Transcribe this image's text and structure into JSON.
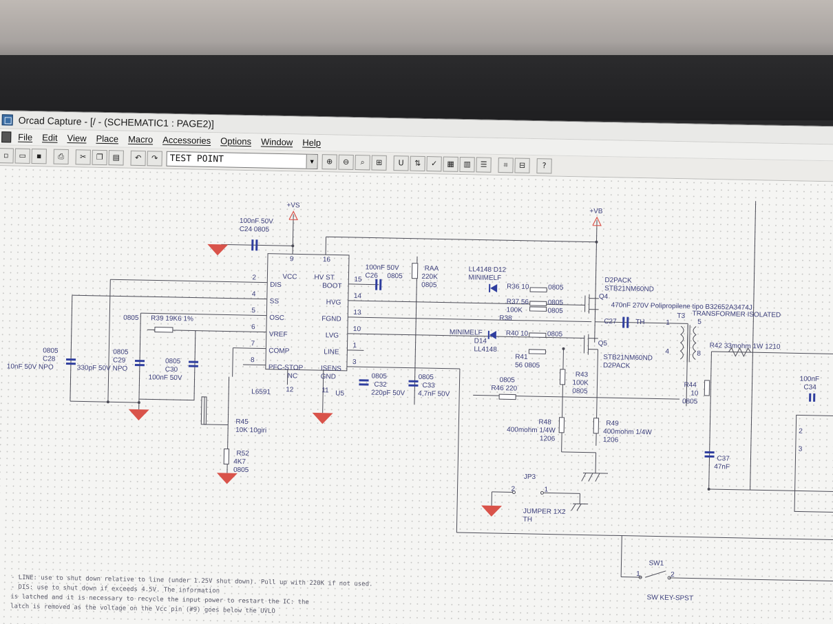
{
  "window": {
    "title": "Orcad Capture - [/ - (SCHEMATIC1 : PAGE2)]"
  },
  "menu": [
    "File",
    "Edit",
    "View",
    "Place",
    "Macro",
    "Accessories",
    "Options",
    "Window",
    "Help"
  ],
  "toolbar": {
    "part_select_value": "TEST POINT",
    "help_button": "?"
  },
  "schematic": {
    "power": {
      "vs": "+VS",
      "vb": "+VB"
    },
    "ic": {
      "name": "L6591",
      "ref": "U5",
      "pins_left": [
        "DIS",
        "SS",
        "OSC",
        "VREF",
        "COMP",
        "PFC-STOP"
      ],
      "pins_right": [
        "HV ST",
        "BOOT",
        "HVG",
        "FGND",
        "LVG",
        "LINE",
        "ISENS"
      ],
      "vcc": "VCC",
      "nc": "NC",
      "gnd": "GND",
      "pin_numbers": {
        "p9": "9",
        "p16": "16",
        "p2": "2",
        "p4": "4",
        "p5": "5",
        "p6": "6",
        "p7": "7",
        "p8": "8",
        "p15": "15",
        "p14": "14",
        "p13": "13",
        "p10": "10",
        "p1": "1",
        "p3": "3",
        "p12": "12",
        "p11": "11"
      }
    },
    "labels": {
      "c24_val": "100nF 50V",
      "c24": "C24 0805",
      "c26_val": "100nF 50V",
      "c26": "C26",
      "c26_pkg": "0805",
      "raa": "RAA",
      "raa_val": "220K",
      "raa_pkg": "0805",
      "d12": "LL4148  D12",
      "d12_pkg": "MINIMELF",
      "r36": "R36 10",
      "r36_pkg": "0805",
      "r37": "R37 56",
      "r37_val": "100K",
      "r37_pkg1": "0805",
      "r37_pkg2": "0805",
      "r38": "R38",
      "d14_pkg": "MINIMELF",
      "d14": "D14",
      "d14_val": "LL4148",
      "r40": "R40 10",
      "r40_pkg": "0805",
      "r41": "R41",
      "r41_val": "56  0805",
      "q4_pkg": "D2PACK",
      "q4_part": "STB21NM60ND",
      "q4": "Q4",
      "c27_desc": "470nF 270V Polipropilene tipo B32652A3474J",
      "c27": "C27",
      "c27_th": "TH",
      "t3": "T3",
      "t3_desc": "TRANSFORMER ISOLATED",
      "t3_p1": "1",
      "t3_p5": "5",
      "t3_p4": "4",
      "t3_p8": "8",
      "q5": "Q5",
      "q5_part": "STB21NM60ND",
      "q5_pkg": "D2PACK",
      "r42": "R42 33mohm 1W  1210",
      "r39_pkg": "0805",
      "r39": "R39 19K6 1%",
      "c28_pkg": "0805",
      "c28": "C28",
      "c28_val": "10nF 50V NPO",
      "c29_pkg": "0805",
      "c29": "C29",
      "c29_val": "330pF 50V NPO",
      "c30_pkg": "0805",
      "c30": "C30",
      "c30_val": "100nF 50V",
      "c32_pkg": "0805",
      "c32": "C32",
      "c32_val": "220pF 50V",
      "c33_pkg": "0805",
      "c33": "C33",
      "c33_val": "4,7nF 50V",
      "r46_pkg": "0805",
      "r46": "R46 220",
      "r43": "R43",
      "r43_val": "100K",
      "r43_pkg": "0805",
      "r44": "R44",
      "r44_val": "10",
      "r44_pkg": "0805",
      "c34_val": "100nF",
      "c34": "C34",
      "r45": "R45",
      "r45_val": "10K 10giri",
      "r52": "R52",
      "r52_val": "4K7",
      "r52_pkg": "0805",
      "r48": "R48",
      "r48_val": "400mohm 1/4W",
      "r48_pkg": "1206",
      "r49": "R49",
      "r49_val": "400mohm 1/4W",
      "r49_pkg": "1206",
      "jp3": "JP3",
      "jp3_p2": "2",
      "jp3_p1": "1",
      "jp3_part": "JUMPER 1X2",
      "jp3_th": "TH",
      "c37": "C37",
      "c37_val": "47nF",
      "sw1": "SW1",
      "sw1_part": "SW KEY-SPST",
      "sw1_p1": "1",
      "sw1_p2": "2",
      "conn_p2": "2",
      "conn_p3": "3"
    },
    "notes": [
      "- LINE: use to shut down relative to line (under 1.25V shut down). Pull up with 220K if not used.",
      "- DIS: use to shut down if exceeds 4.5V. The information",
      "is latched and it is necessary to recycle the input power to restart the IC: the",
      "latch is removed as the voltage on the Vcc pin (#9) goes below the UVLO"
    ]
  },
  "colors": {
    "wire": "#4a4a55",
    "component": "#2f3e9e",
    "ground": "#d9534a",
    "text": "#3a3d7a"
  }
}
